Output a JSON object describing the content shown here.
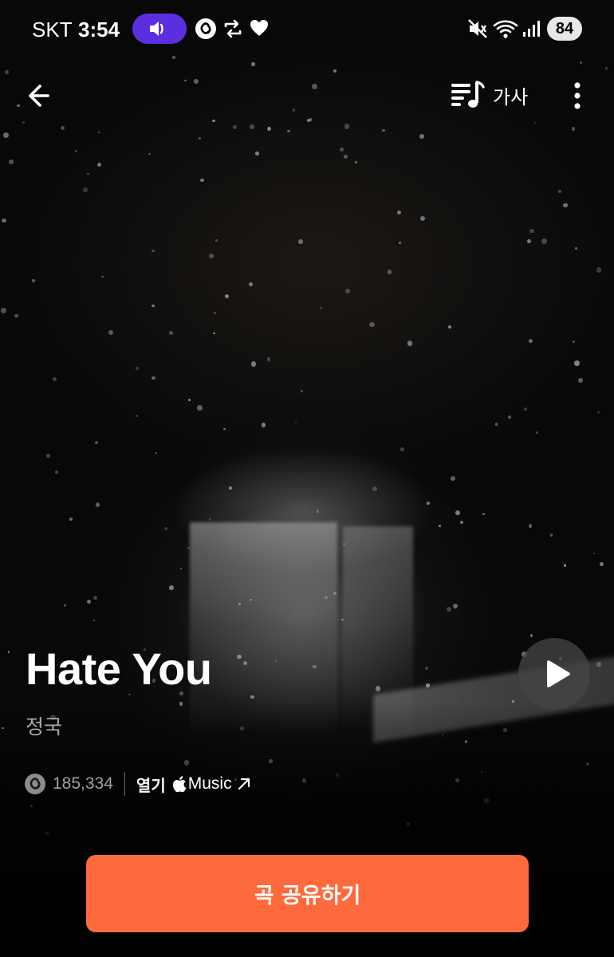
{
  "status_bar": {
    "carrier": "SKT",
    "time": "3:54",
    "battery": "84"
  },
  "header": {
    "lyrics_label": "가사"
  },
  "song": {
    "title": "Hate You",
    "artist": "정국",
    "shazam_count": "185,334"
  },
  "open_link": {
    "open_label": "열기",
    "service_label": "Music"
  },
  "share_button": {
    "label": "곡 공유하기"
  },
  "colors": {
    "accent": "#ff6a3d",
    "pill": "#5b2fe0"
  }
}
